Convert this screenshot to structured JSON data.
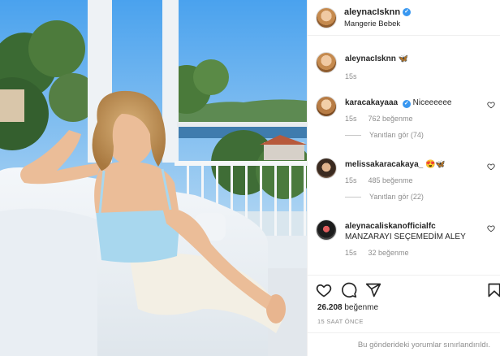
{
  "post": {
    "username": "aleynacIsknn",
    "location": "Mangerie Bebek",
    "caption_emoji": "🦋",
    "caption_time": "15s",
    "likes_count": "26.208",
    "likes_label": "beğenme",
    "posted_ago": "15 SAAT ÖNCE",
    "restricted_notice": "Bu gönderideki yorumlar sınırlandırıldı."
  },
  "comments": [
    {
      "username": "karacakayaaa",
      "verified": true,
      "text": "Niceeeeee",
      "time": "15s",
      "likes": "762 beğenme",
      "replies": "Yanıtları gör (74)"
    },
    {
      "username": "melissakaracakaya_",
      "verified": false,
      "text": "😍🦋",
      "time": "15s",
      "likes": "485 beğenme",
      "replies": "Yanıtları gör (22)"
    },
    {
      "username": "aleynacaliskanofficialfc",
      "verified": false,
      "text": "MANZARAYI SEÇEMEDİM ALEY",
      "time": "15s",
      "likes": "32 beğenme"
    }
  ],
  "icons": {
    "like": "heart-icon",
    "comment": "comment-icon",
    "share": "share-icon",
    "save": "bookmark-icon",
    "verified": "verified-badge-icon"
  },
  "colors": {
    "verified_blue": "#3897f0",
    "muted_text": "#8e8e8e"
  }
}
